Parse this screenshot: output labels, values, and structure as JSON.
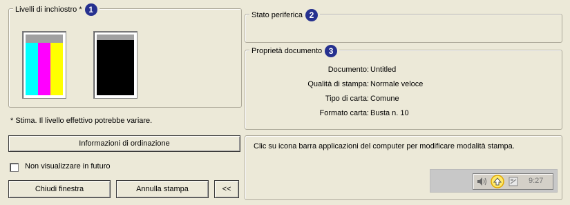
{
  "ink_levels": {
    "title": "Livelli di inchiostro *",
    "callout": "1",
    "footnote": "* Stima. Il livello effettivo potrebbe variare.",
    "colors": {
      "gray": "#a0a0a0",
      "cyan": "#00ffff",
      "magenta": "#ff00ff",
      "yellow": "#ffff00",
      "black": "#000000"
    }
  },
  "device_status": {
    "title": "Stato periferica",
    "callout": "2"
  },
  "document_properties": {
    "title": "Proprietà documento",
    "callout": "3",
    "rows": [
      {
        "label": "Documento:",
        "value": "Untitled"
      },
      {
        "label": "Qualità di stampa:",
        "value": "Normale veloce"
      },
      {
        "label": "Tipo di carta:",
        "value": "Comune"
      },
      {
        "label": "Formato carta:",
        "value": "Busta n. 10"
      }
    ]
  },
  "buttons": {
    "order_info": "Informazioni di ordinazione",
    "close_window": "Chiudi finestra",
    "cancel_print": "Annulla stampa",
    "collapse": "<<"
  },
  "checkbox": {
    "label": "Non visualizzare in futuro",
    "checked": false
  },
  "info_panel": {
    "text": "Clic su icona barra applicazioni del computer per modificare modalità stampa.",
    "tray_time": "9:27"
  },
  "accent_color": "#26318f"
}
